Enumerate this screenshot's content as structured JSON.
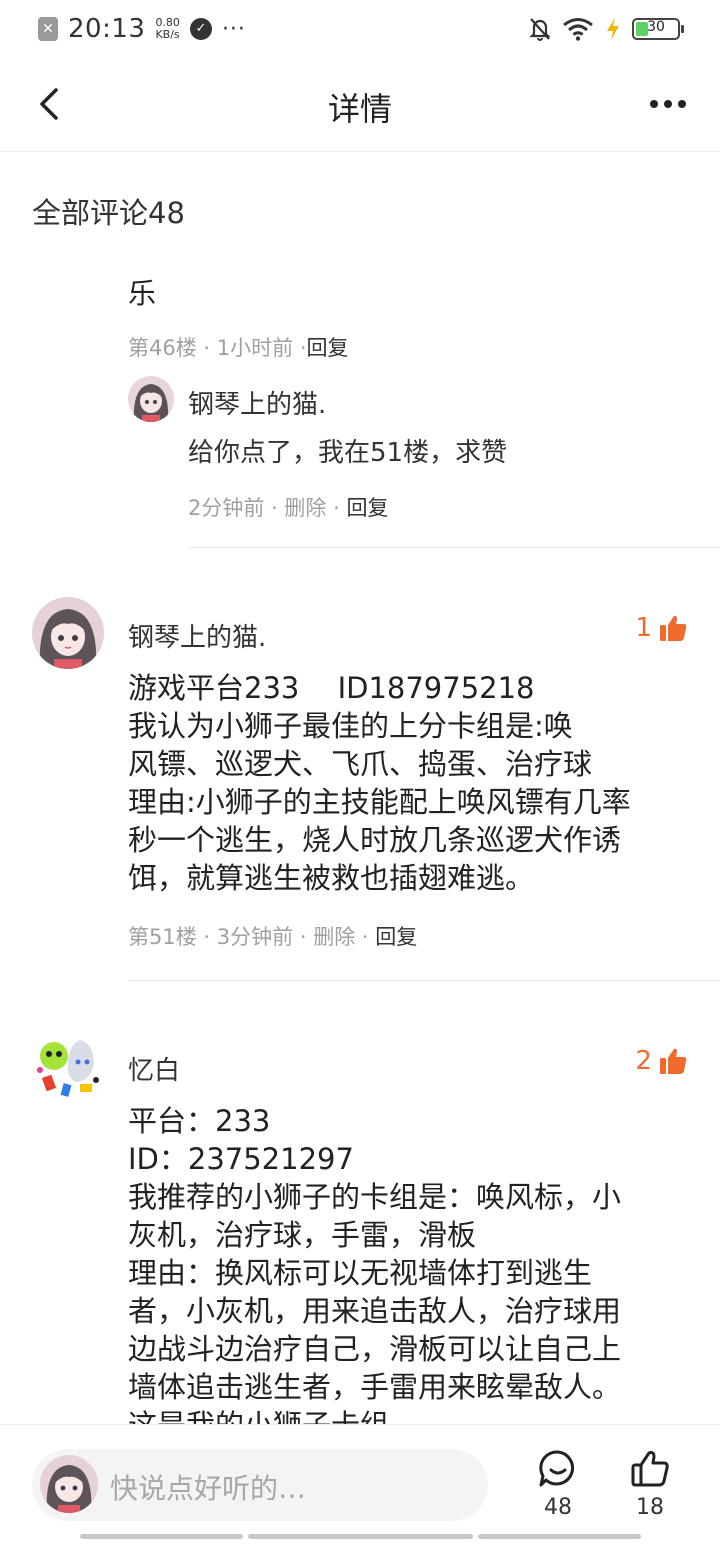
{
  "status_bar": {
    "time": "20:13",
    "speed_value": "0.80",
    "speed_unit": "KB/s",
    "battery": "30",
    "battery_level": 0.3
  },
  "header": {
    "title": "详情"
  },
  "comments": {
    "header": "全部评论48"
  },
  "truncated_comment": {
    "text_tail": "乐",
    "floor": "第46楼",
    "time": "1小时前",
    "reply_label": "回复",
    "sub_reply": {
      "name": "钢琴上的猫.",
      "text": "给你点了，我在51楼，求赞",
      "time": "2分钟前",
      "delete_label": "删除",
      "reply_label": "回复"
    }
  },
  "comment_list": [
    {
      "name": "钢琴上的猫.",
      "likes": "1",
      "lines": [
        "游戏平台233　 ID187975218",
        "我认为小狮子最佳的上分卡组是:唤",
        "风镖、巡逻犬、飞爪、捣蛋、治疗球",
        "理由:小狮子的主技能配上唤风镖有几率",
        "秒一个逃生，烧人时放几条巡逻犬作诱",
        "饵，就算逃生被救也插翅难逃。"
      ],
      "floor": "第51楼",
      "time": "3分钟前",
      "delete_label": "删除",
      "reply_label": "回复"
    },
    {
      "name": "忆白",
      "likes": "2",
      "lines": [
        "平台：233",
        "ID：237521297",
        "我推荐的小狮子的卡组是：唤风标，小",
        "灰机，治疗球，手雷，滑板",
        "理由：换风标可以无视墙体打到逃生",
        "者，小灰机，用来追击敌人，治疗球用",
        "边战斗边治疗自己，滑板可以让自己上",
        "墙体追击逃生者，手雷用来眩晕敌人。",
        "这是我的小狮子卡组"
      ]
    }
  ],
  "bottom_bar": {
    "input_placeholder": "快说点好听的…",
    "comment_count": "48",
    "like_count": "18"
  },
  "colors": {
    "accent": "#f06a2b",
    "meta_gray": "#a0a0a0",
    "divider": "#ececec"
  }
}
